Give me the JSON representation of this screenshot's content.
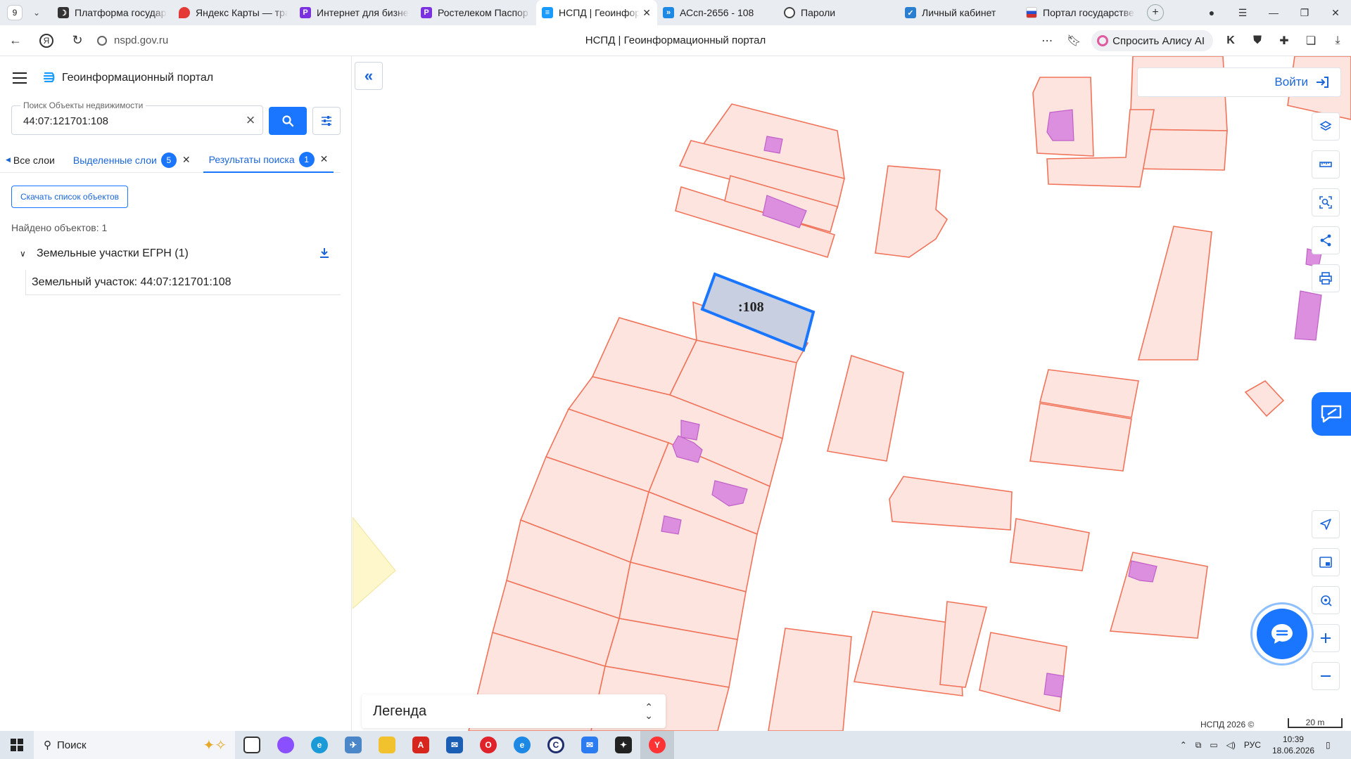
{
  "browser": {
    "tab_count": "9",
    "tabs": [
      {
        "title": "Платформа государс",
        "icon": "moon-icon",
        "color": "#333333"
      },
      {
        "title": "Яндекс Карты — тра",
        "icon": "map-pin-icon",
        "color": "#e53935"
      },
      {
        "title": "Интернет для бизне",
        "icon": "rostelecom-icon",
        "color": "#7a32e0"
      },
      {
        "title": "Ростелеком Паспор",
        "icon": "rostelecom-icon",
        "color": "#7a32e0"
      },
      {
        "title": "НСПД | Геоинфор",
        "icon": "nspd-icon",
        "color": "#1a9bff",
        "active": true
      },
      {
        "title": "АСсп-2656 - 108",
        "icon": "double-arrow-icon",
        "color": "#1e88e5"
      },
      {
        "title": "Пароли",
        "icon": "key-ring-icon",
        "color": "#444444"
      },
      {
        "title": "Личный кабинет",
        "icon": "kabinet-icon",
        "color": "#2a7fd1"
      },
      {
        "title": "Портал государстве",
        "icon": "russia-flag-icon",
        "color": "#d32f2f"
      }
    ],
    "url": "nspd.gov.ru",
    "page_title": "НСПД | Геоинформационный портал",
    "alice_label": "Спросить Алису AI"
  },
  "panel": {
    "brand_title": "Геоинформационный портал",
    "search": {
      "label": "Поиск Объекты недвижимости",
      "value": "44:07:121701:108"
    },
    "tabs": {
      "all_layers": "Все слои",
      "selected_layers": "Выделенные слои",
      "selected_count": "5",
      "search_results": "Результаты поиска",
      "results_count": "1"
    },
    "download_list_label": "Скачать список объектов",
    "found_text": "Найдено объектов: 1",
    "group_label": "Земельные участки ЕГРН (1)",
    "result_item": "Земельный участок: 44:07:121701:108"
  },
  "map": {
    "login_label": "Войти",
    "selected_parcel_label": ":108",
    "legend_label": "Легенда",
    "copyright": "НСПД 2026 ©",
    "scale_label": "20 m",
    "colors": {
      "parcel_fill": "#fde4de",
      "parcel_stroke": "#f0735a",
      "building_fill": "#dc8fde",
      "building_stroke": "#c060c8",
      "selected_fill": "#c8cfe0",
      "selected_stroke": "#1a75ff",
      "accent": "#1a75ff"
    }
  },
  "taskbar": {
    "search_placeholder": "Поиск",
    "lang": "РУС",
    "time": "10:39",
    "date": "18.06.2026"
  }
}
